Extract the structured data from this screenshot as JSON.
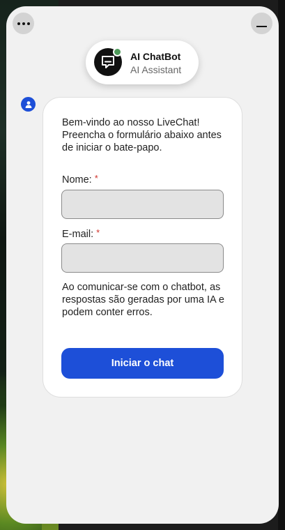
{
  "header": {
    "menu_icon": "more-dots-icon",
    "minimize_icon": "minimize-icon"
  },
  "agent": {
    "name": "AI ChatBot",
    "role": "AI Assistant",
    "avatar_icon": "chat-bubble-icon",
    "status_color": "#4e9a5a"
  },
  "form": {
    "intro": "Bem-vindo ao nosso LiveChat! Preencha o formulário abaixo antes de iniciar o bate-papo.",
    "name_label": "Nome:",
    "email_label": "E-mail:",
    "required_marker": "*",
    "name_value": "",
    "email_value": "",
    "disclaimer": "Ao comunicar-se com o chatbot, as respostas são geradas por uma IA e podem conter erros.",
    "submit_label": "Iniciar o chat"
  },
  "colors": {
    "accent": "#1d4fd8",
    "required": "#d0332c"
  }
}
